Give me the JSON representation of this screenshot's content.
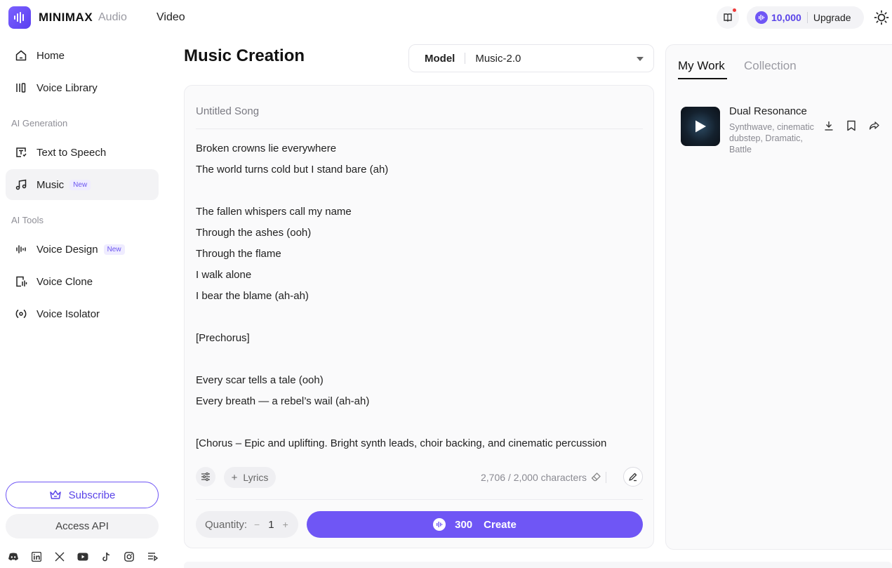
{
  "header": {
    "logo_text": "MINIMAX",
    "nav": [
      {
        "label": "Audio"
      },
      {
        "label": "Video"
      }
    ],
    "credits": "10,000",
    "upgrade_label": "Upgrade"
  },
  "sidebar": {
    "items": [
      {
        "label": "Home",
        "icon": "home-icon"
      },
      {
        "label": "Voice Library",
        "icon": "library-icon"
      }
    ],
    "section_generation": "AI Generation",
    "generation_items": [
      {
        "label": "Text to Speech",
        "icon": "text-to-speech-icon"
      },
      {
        "label": "Music",
        "icon": "music-note-icon",
        "badge": "New",
        "active": true
      }
    ],
    "section_tools": "AI Tools",
    "tools_items": [
      {
        "label": "Voice Design",
        "icon": "voice-design-icon",
        "badge": "New"
      },
      {
        "label": "Voice Clone",
        "icon": "voice-clone-icon"
      },
      {
        "label": "Voice Isolator",
        "icon": "voice-isolator-icon"
      }
    ],
    "subscribe_label": "Subscribe",
    "api_label": "Access API",
    "social_icons": [
      "discord-icon",
      "linkedin-icon",
      "x-icon",
      "youtube-icon",
      "tiktok-icon",
      "instagram-icon",
      "blog-icon"
    ]
  },
  "main": {
    "title": "Music Creation",
    "model_label": "Model",
    "model_value": "Music-2.0",
    "song_title_placeholder": "Untitled Song",
    "lyrics": [
      "Broken crowns lie everywhere",
      "The world turns cold but I stand bare (ah)",
      "",
      "The fallen whispers call my name",
      "Through the ashes (ooh)",
      "Through the flame",
      "I walk alone",
      "I bear the blame (ah-ah)",
      "",
      "[Prechorus]",
      "",
      "Every scar tells a tale (ooh)",
      "Every breath — a rebel’s wail (ah-ah)",
      "",
      "[Chorus – Epic and uplifting. Bright synth leads, choir backing, and cinematic percussion"
    ],
    "lyrics_button": "Lyrics",
    "char_count": "2,706 / 2,000 characters",
    "quantity_label": "Quantity:",
    "quantity_minus": "−",
    "quantity_value": "1",
    "quantity_plus": "+",
    "create_cost": "300",
    "create_label": "Create"
  },
  "right_panel": {
    "tabs": [
      {
        "label": "My Work",
        "active": true
      },
      {
        "label": "Collection"
      }
    ],
    "tracks": [
      {
        "title": "Dual Resonance",
        "tags": "Synthwave, cinematic dubstep, Dramatic, Battle"
      }
    ]
  },
  "colors": {
    "accent": "#6f56f5",
    "accent_text": "#5a44e8",
    "notification": "#ef3b3b"
  }
}
